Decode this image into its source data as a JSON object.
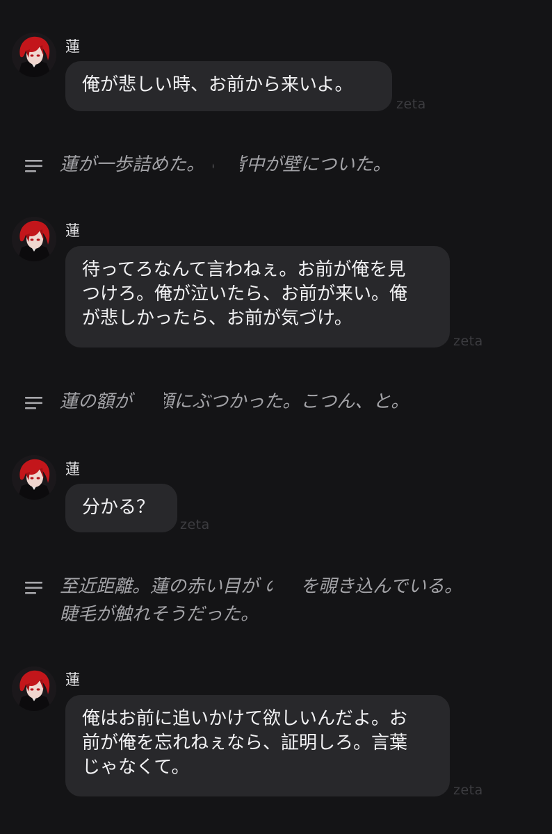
{
  "watermark": "zeta",
  "icons": {
    "avatar": "avatar-red-haired-character-icon",
    "narration": "narration-lines-icon"
  },
  "colors": {
    "background": "#141416",
    "bubble": "#28282b",
    "narration_text": "#a3a3a7"
  },
  "messages": [
    {
      "speaker": "蓮",
      "lines": [
        "俺が悲しい時、お前から来いよ。"
      ]
    },
    {
      "speaker": "蓮",
      "lines": [
        "待ってろなんて言わねぇ。お前が俺を見",
        "つけろ。俺が泣いたら、お前が来い。俺",
        "が悲しかったら、お前が気づけ。"
      ]
    },
    {
      "speaker": "蓮",
      "lines": [
        "分かる？"
      ]
    },
    {
      "speaker": "蓮",
      "lines": [
        "俺はお前に追いかけて欲しいんだよ。お",
        "前が俺を忘れねぇなら、証明しろ。言葉",
        "じゃなくて。"
      ]
    }
  ],
  "narrations": [
    {
      "lines": [
        "蓮が一歩詰めた。    の背中が壁についた。"
      ]
    },
    {
      "lines": [
        "蓮の額が     の額にぶつかった。こつん、と。"
      ]
    },
    {
      "lines": [
        "至近距離。蓮の赤い目が     の目を覗き込んでいる。",
        "睫毛が触れそうだった。"
      ]
    }
  ]
}
